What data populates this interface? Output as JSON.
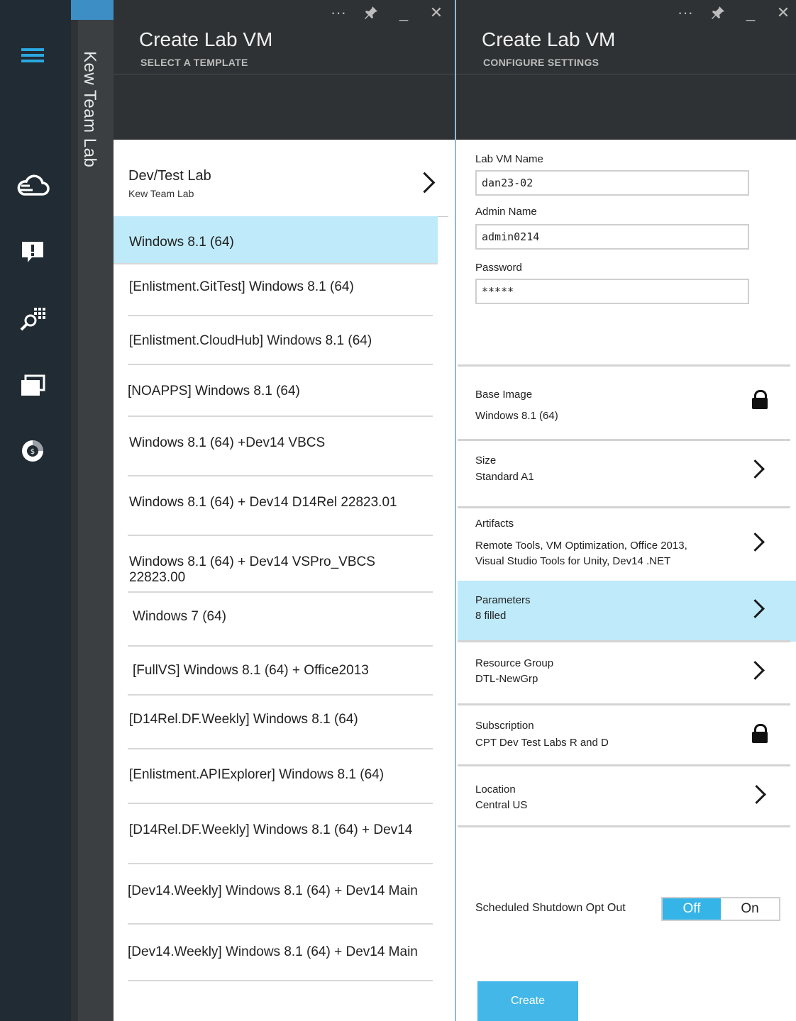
{
  "nav": {
    "items": [
      {
        "name": "menu",
        "icon": "hamburger-menu-icon"
      },
      {
        "name": "cloud",
        "icon": "cloud-icon"
      },
      {
        "name": "notifications",
        "icon": "notification-icon"
      },
      {
        "name": "browse",
        "icon": "search-grid-icon"
      },
      {
        "name": "windows",
        "icon": "windows-icon"
      },
      {
        "name": "billing",
        "icon": "billing-icon"
      }
    ]
  },
  "journey": {
    "title": "Kew Team Lab"
  },
  "template_blade": {
    "title": "Create Lab VM",
    "subtitle": "SELECT A TEMPLATE",
    "lab": {
      "name": "Dev/Test Lab",
      "subtitle": "Kew Team Lab"
    },
    "templates": [
      "Windows 8.1 (64)",
      "[Enlistment.GitTest] Windows 8.1 (64)",
      "[Enlistment.CloudHub] Windows 8.1 (64)",
      "[NOAPPS] Windows 8.1 (64)",
      "Windows 8.1 (64) +Dev14 VBCS",
      "Windows 8.1 (64) + Dev14 D14Rel 22823.01",
      "Windows 8.1 (64) + Dev14 VSPro_VBCS 22823.00",
      "Windows 7 (64)",
      "[FullVS] Windows 8.1 (64) + Office2013",
      "[D14Rel.DF.Weekly] Windows 8.1 (64)",
      "[Enlistment.APIExplorer] Windows 8.1 (64)",
      "[D14Rel.DF.Weekly] Windows 8.1 (64) + Dev14",
      "[Dev14.Weekly] Windows 8.1 (64) + Dev14 Main",
      "[Dev14.Weekly] Windows 8.1 (64) + Dev14 Main"
    ],
    "selected_index": 0
  },
  "config_blade": {
    "title": "Create Lab VM",
    "subtitle": "CONFIGURE SETTINGS",
    "fields": {
      "vm_name_label": "Lab VM Name",
      "vm_name_value": "dan23-02",
      "admin_label": "Admin Name",
      "admin_value": "admin0214",
      "password_label": "Password",
      "password_value": "*****"
    },
    "settings": {
      "base_image_label": "Base Image",
      "base_image_value": "Windows 8.1 (64)",
      "size_label": "Size",
      "size_value": "Standard A1",
      "artifacts_label": "Artifacts",
      "artifacts_line1": "Remote Tools, VM Optimization, Office 2013,",
      "artifacts_line2": "Visual Studio Tools for Unity, Dev14 .NET",
      "parameters_label": "Parameters",
      "parameters_value": "8 filled",
      "resource_group_label": "Resource Group",
      "resource_group_value": "DTL-NewGrp",
      "subscription_label": "Subscription",
      "subscription_value": "CPT Dev Test Labs R and D",
      "location_label": "Location",
      "location_value": "Central US"
    },
    "shutdown": {
      "label": "Scheduled Shutdown Opt Out",
      "off_label": "Off",
      "on_label": "On",
      "selected": "Off"
    },
    "create_label": "Create"
  },
  "window_tools": {
    "more": "···",
    "minimize": "_",
    "close": "✕"
  },
  "colors": {
    "accent": "#43b7e8",
    "selection": "#bfeaf9",
    "rail": "#212b33",
    "header": "#2f3234"
  }
}
